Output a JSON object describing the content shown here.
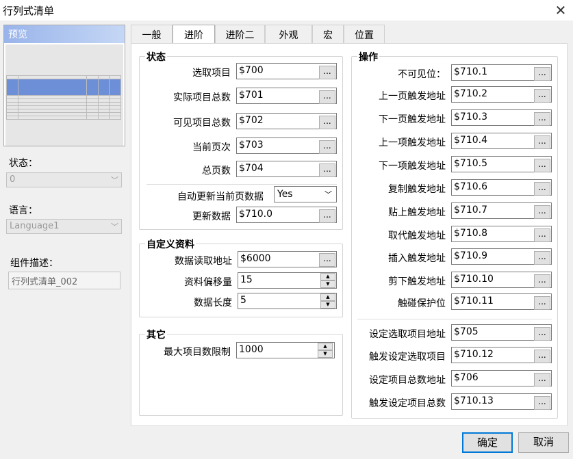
{
  "window": {
    "title": "行列式清单",
    "close_glyph": "✕"
  },
  "left": {
    "preview_label": "预览",
    "state_label": "状态：",
    "state_value": "0",
    "language_label": "语言：",
    "language_value": "Language1",
    "desc_label": "组件描述：",
    "desc_value": "行列式清单_002"
  },
  "tabs": [
    "一般",
    "进阶",
    "进阶二",
    "外观",
    "宏",
    "位置"
  ],
  "status": {
    "title": "状态",
    "rows": [
      {
        "label": "选取项目",
        "value": "$700"
      },
      {
        "label": "实际项目总数",
        "value": "$701"
      },
      {
        "label": "可见项目总数",
        "value": "$702"
      },
      {
        "label": "当前页次",
        "value": "$703"
      },
      {
        "label": "总页数",
        "value": "$704"
      }
    ],
    "auto_update_label": "自动更新当前页数据",
    "auto_update_value": "Yes",
    "update_label": "更新数据",
    "update_value": "$710.0"
  },
  "custom": {
    "title": "自定义资料",
    "read_addr_label": "数据读取地址",
    "read_addr_value": "$6000",
    "offset_label": "资料偏移量",
    "offset_value": "15",
    "length_label": "数据长度",
    "length_value": "5"
  },
  "other": {
    "title": "其它",
    "max_label": "最大项目数限制",
    "max_value": "1000"
  },
  "ops": {
    "title": "操作",
    "rows": [
      {
        "label": "不可见位：",
        "value": "$710.1"
      },
      {
        "label": "上一页触发地址",
        "value": "$710.2"
      },
      {
        "label": "下一页触发地址",
        "value": "$710.3"
      },
      {
        "label": "上一项触发地址",
        "value": "$710.4"
      },
      {
        "label": "下一项触发地址",
        "value": "$710.5"
      },
      {
        "label": "复制触发地址",
        "value": "$710.6"
      },
      {
        "label": "贴上触发地址",
        "value": "$710.7"
      },
      {
        "label": "取代触发地址",
        "value": "$710.8"
      },
      {
        "label": "插入触发地址",
        "value": "$710.9"
      },
      {
        "label": "剪下触发地址",
        "value": "$710.10"
      },
      {
        "label": "触碰保护位",
        "value": "$710.11"
      }
    ],
    "rows2": [
      {
        "label": "设定选取项目地址",
        "value": "$705"
      },
      {
        "label": "触发设定选取项目",
        "value": "$710.12"
      },
      {
        "label": "设定项目总数地址",
        "value": "$706"
      },
      {
        "label": "触发设定项目总数",
        "value": "$710.13"
      }
    ]
  },
  "browse_glyph": "...",
  "footer": {
    "ok": "确定",
    "cancel": "取消"
  }
}
